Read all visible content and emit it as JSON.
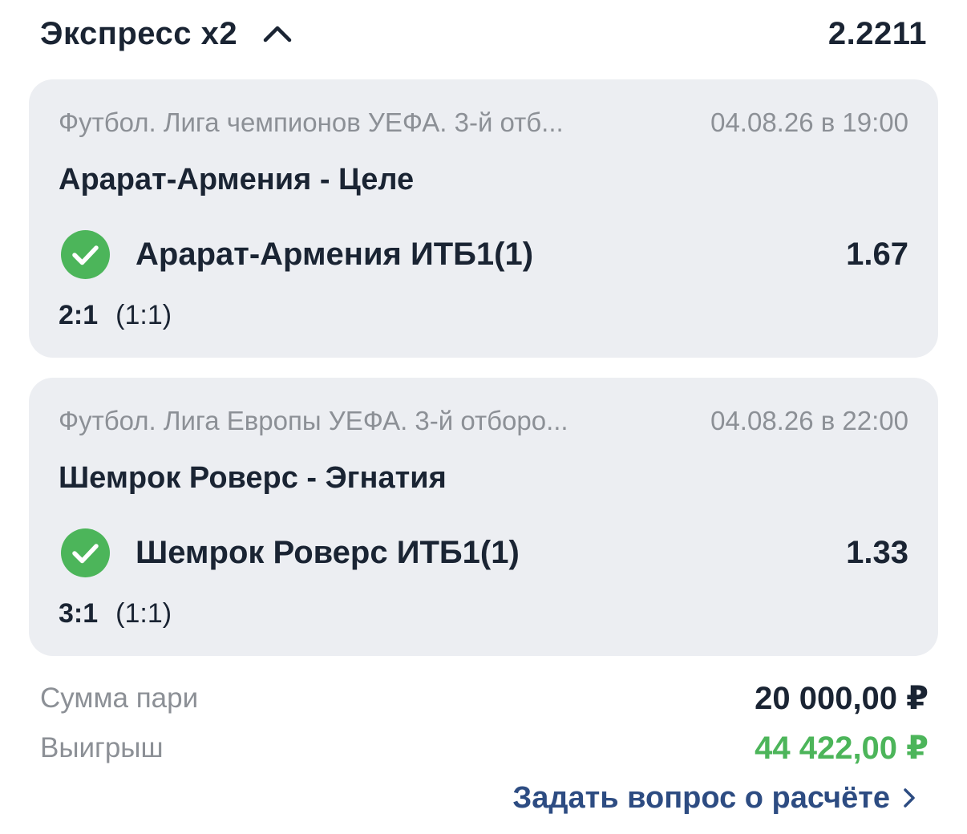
{
  "header": {
    "title": "Экспресс x2",
    "total_odds": "2.2211",
    "collapse_icon": "chevron-up-icon"
  },
  "events": [
    {
      "league": "Футбол. Лига чемпионов УЕФА. 3-й отб...",
      "datetime": "04.08.26 в 19:00",
      "match": "Арарат-Армения - Целе",
      "selection": "Арарат-Армения ИТБ1(1)",
      "odds": "1.67",
      "status_icon": "check-circle-icon",
      "status_color": "#4cb55a",
      "score": "2:1",
      "half_score": "(1:1)"
    },
    {
      "league": "Футбол. Лига Европы УЕФА. 3-й отборо...",
      "datetime": "04.08.26 в 22:00",
      "match": "Шемрок Роверс - Эгнатия",
      "selection": "Шемрок Роверс ИТБ1(1)",
      "odds": "1.33",
      "status_icon": "check-circle-icon",
      "status_color": "#4cb55a",
      "score": "3:1",
      "half_score": "(1:1)"
    }
  ],
  "summary": {
    "stake_label": "Сумма пари",
    "stake_value": "20 000,00 ₽",
    "win_label": "Выигрыш",
    "win_value": "44 422,00 ₽",
    "win_color": "#4cb55a"
  },
  "ask_link": {
    "label": "Задать вопрос о расчёте",
    "icon": "chevron-right-icon",
    "color": "#2d4c82"
  }
}
